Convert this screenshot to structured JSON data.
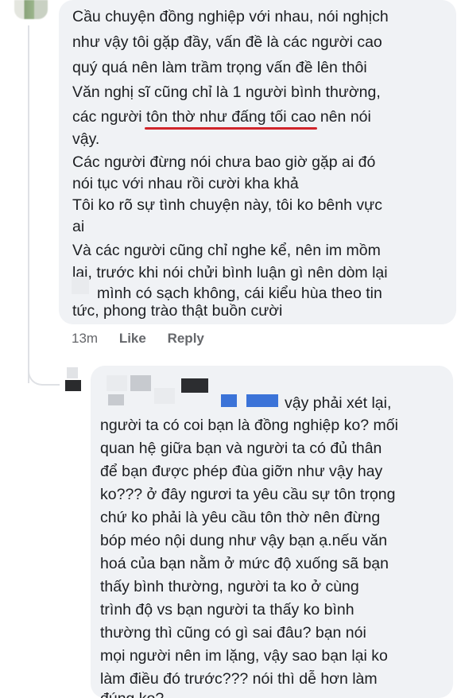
{
  "comment1": {
    "lines": [
      "Cầu chuyện đồng nghiệp với nhau, nói nghịch",
      "như vậy tôi gặp đầy, vấn đề là các người cao",
      "quý quá nên làm trầm trọng vấn đề lên thôi",
      "Văn nghị sĩ cũng chỉ là 1 người bình thường,",
      "các người ",
      "tôn thờ như đấng tối cao",
      " nên nói",
      "vậy.",
      "Các người đừng nói chưa bao giờ gặp ai đó",
      "nói tục với nhau rồi cười kha khả",
      "Tôi ko rõ sự tình chuyện này, tôi ko bênh vực",
      "ai",
      "Và các người cũng chỉ nghe kể, nên im mồm",
      "lại, trước khi nói chửi bình luận gì nên dòm lại",
      "mình có sạch không, cái kiểu hùa theo tin",
      "tức, phong trào thật buồn cười"
    ],
    "time": "13m",
    "like_label": "Like",
    "reply_label": "Reply"
  },
  "comment2": {
    "first_line": "vậy phải xét lại,",
    "lines": [
      "người ta có coi bạn là đồng nghiệp ko? mối",
      "quan hệ giữa bạn và người ta có đủ thân",
      "để bạn được phép đùa giỡn như vậy hay",
      "ko??? ở đây ngươi ta yêu cầu sự tôn trọng",
      "chứ ko phải là yêu cầu tôn thờ nên đừng",
      "bóp méo nội dung như vậy bạn ạ.nếu văn",
      "hoá của bạn nằm ở mức độ xuống sã bạn",
      "thấy bình thường, người ta ko ở cùng",
      "trình độ vs bạn người ta thấy ko bình",
      "thường thì cũng có gì sai đâu? bạn nói",
      "mọi người nên im lặng, vậy sao bạn lại ko",
      "làm điều đó trước??? nói thì dễ hơn làm",
      "đúng ko?"
    ]
  },
  "colors": {
    "bubble": "#f0f2f5",
    "underline": "#d0252b",
    "meta": "#65676b",
    "mention": "#3b73d8"
  }
}
